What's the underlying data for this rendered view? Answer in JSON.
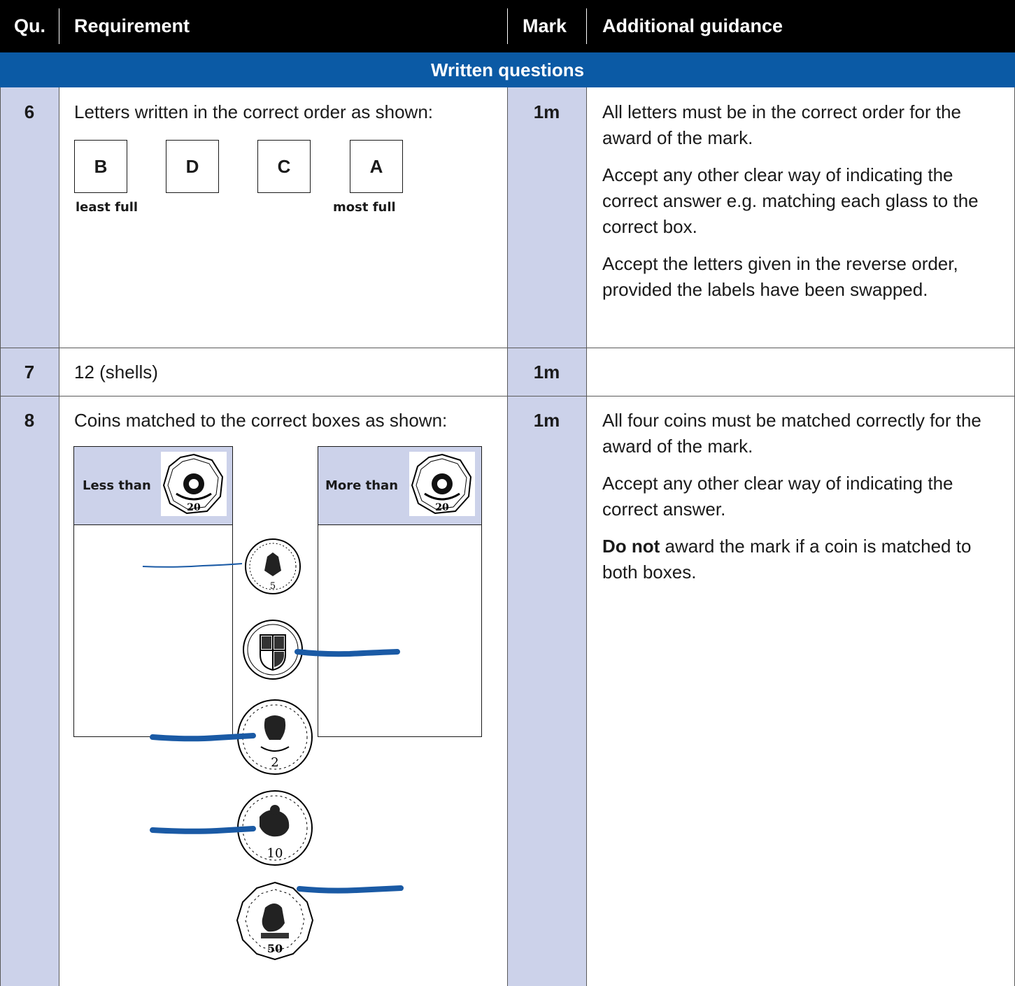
{
  "header": {
    "qu": "Qu.",
    "requirement": "Requirement",
    "mark": "Mark",
    "guidance": "Additional guidance"
  },
  "section_title": "Written questions",
  "colors": {
    "header_bg": "#000000",
    "section_bg": "#0b5aa5",
    "shade": "#ccd2ea",
    "line": "#1a5aa5"
  },
  "rows": [
    {
      "qu": "6",
      "requirement": "Letters written in the correct order as shown:",
      "boxes": [
        "B",
        "D",
        "C",
        "A"
      ],
      "left_label": "least full",
      "right_label": "most full",
      "mark": "1m",
      "guidance": [
        "All letters must be in the correct order for the award of the mark.",
        "Accept any other clear way of indicating the correct answer e.g. matching each glass to the correct box.",
        "Accept the letters given in the reverse order, provided the labels have been swapped."
      ]
    },
    {
      "qu": "7",
      "requirement": "12 (shells)",
      "mark": "1m"
    },
    {
      "qu": "8",
      "requirement": "Coins matched to the correct boxes as shown:",
      "less_label": "Less than",
      "more_label": "More than",
      "coins": [
        {
          "icon": "five-pence-coin-icon",
          "value": "5",
          "matched_to": "Less than"
        },
        {
          "icon": "one-pound-coin-icon",
          "value": "",
          "matched_to": "More than"
        },
        {
          "icon": "two-pence-coin-icon",
          "value": "2",
          "matched_to": "Less than"
        },
        {
          "icon": "ten-pence-coin-icon",
          "value": "10",
          "matched_to": "Less than"
        },
        {
          "icon": "fifty-pence-coin-icon",
          "value": "50",
          "matched_to": "More than"
        }
      ],
      "ref_coin_value": "20",
      "mark": "1m",
      "guidance": [
        "All four coins must be matched correctly for the award of the mark.",
        "Accept any other clear way of indicating the correct answer.",
        {
          "bold": "Do not",
          "rest": " award the mark if a coin is matched to both boxes."
        }
      ]
    }
  ]
}
